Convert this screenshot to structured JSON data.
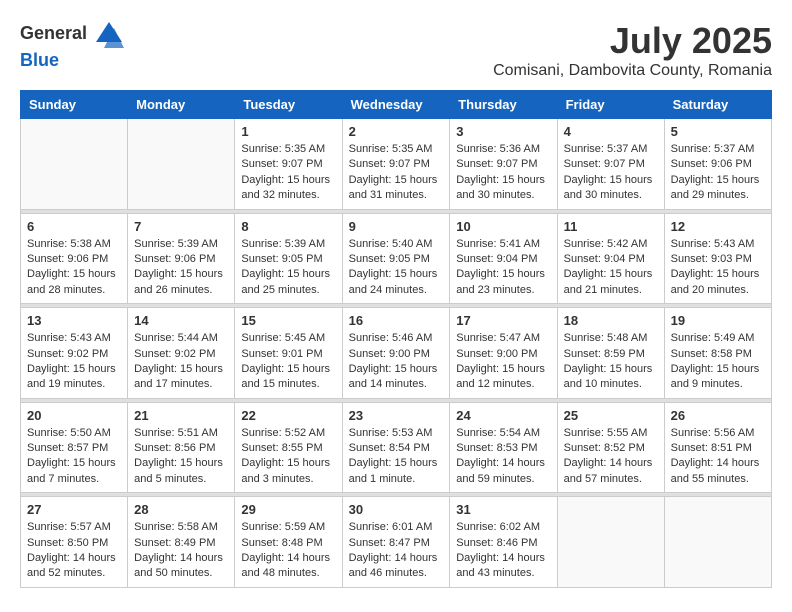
{
  "header": {
    "logo_general": "General",
    "logo_blue": "Blue",
    "month_year": "July 2025",
    "location": "Comisani, Dambovita County, Romania"
  },
  "weekdays": [
    "Sunday",
    "Monday",
    "Tuesday",
    "Wednesday",
    "Thursday",
    "Friday",
    "Saturday"
  ],
  "weeks": [
    [
      {
        "day": "",
        "info": ""
      },
      {
        "day": "",
        "info": ""
      },
      {
        "day": "1",
        "info": "Sunrise: 5:35 AM\nSunset: 9:07 PM\nDaylight: 15 hours and 32 minutes."
      },
      {
        "day": "2",
        "info": "Sunrise: 5:35 AM\nSunset: 9:07 PM\nDaylight: 15 hours and 31 minutes."
      },
      {
        "day": "3",
        "info": "Sunrise: 5:36 AM\nSunset: 9:07 PM\nDaylight: 15 hours and 30 minutes."
      },
      {
        "day": "4",
        "info": "Sunrise: 5:37 AM\nSunset: 9:07 PM\nDaylight: 15 hours and 30 minutes."
      },
      {
        "day": "5",
        "info": "Sunrise: 5:37 AM\nSunset: 9:06 PM\nDaylight: 15 hours and 29 minutes."
      }
    ],
    [
      {
        "day": "6",
        "info": "Sunrise: 5:38 AM\nSunset: 9:06 PM\nDaylight: 15 hours and 28 minutes."
      },
      {
        "day": "7",
        "info": "Sunrise: 5:39 AM\nSunset: 9:06 PM\nDaylight: 15 hours and 26 minutes."
      },
      {
        "day": "8",
        "info": "Sunrise: 5:39 AM\nSunset: 9:05 PM\nDaylight: 15 hours and 25 minutes."
      },
      {
        "day": "9",
        "info": "Sunrise: 5:40 AM\nSunset: 9:05 PM\nDaylight: 15 hours and 24 minutes."
      },
      {
        "day": "10",
        "info": "Sunrise: 5:41 AM\nSunset: 9:04 PM\nDaylight: 15 hours and 23 minutes."
      },
      {
        "day": "11",
        "info": "Sunrise: 5:42 AM\nSunset: 9:04 PM\nDaylight: 15 hours and 21 minutes."
      },
      {
        "day": "12",
        "info": "Sunrise: 5:43 AM\nSunset: 9:03 PM\nDaylight: 15 hours and 20 minutes."
      }
    ],
    [
      {
        "day": "13",
        "info": "Sunrise: 5:43 AM\nSunset: 9:02 PM\nDaylight: 15 hours and 19 minutes."
      },
      {
        "day": "14",
        "info": "Sunrise: 5:44 AM\nSunset: 9:02 PM\nDaylight: 15 hours and 17 minutes."
      },
      {
        "day": "15",
        "info": "Sunrise: 5:45 AM\nSunset: 9:01 PM\nDaylight: 15 hours and 15 minutes."
      },
      {
        "day": "16",
        "info": "Sunrise: 5:46 AM\nSunset: 9:00 PM\nDaylight: 15 hours and 14 minutes."
      },
      {
        "day": "17",
        "info": "Sunrise: 5:47 AM\nSunset: 9:00 PM\nDaylight: 15 hours and 12 minutes."
      },
      {
        "day": "18",
        "info": "Sunrise: 5:48 AM\nSunset: 8:59 PM\nDaylight: 15 hours and 10 minutes."
      },
      {
        "day": "19",
        "info": "Sunrise: 5:49 AM\nSunset: 8:58 PM\nDaylight: 15 hours and 9 minutes."
      }
    ],
    [
      {
        "day": "20",
        "info": "Sunrise: 5:50 AM\nSunset: 8:57 PM\nDaylight: 15 hours and 7 minutes."
      },
      {
        "day": "21",
        "info": "Sunrise: 5:51 AM\nSunset: 8:56 PM\nDaylight: 15 hours and 5 minutes."
      },
      {
        "day": "22",
        "info": "Sunrise: 5:52 AM\nSunset: 8:55 PM\nDaylight: 15 hours and 3 minutes."
      },
      {
        "day": "23",
        "info": "Sunrise: 5:53 AM\nSunset: 8:54 PM\nDaylight: 15 hours and 1 minute."
      },
      {
        "day": "24",
        "info": "Sunrise: 5:54 AM\nSunset: 8:53 PM\nDaylight: 14 hours and 59 minutes."
      },
      {
        "day": "25",
        "info": "Sunrise: 5:55 AM\nSunset: 8:52 PM\nDaylight: 14 hours and 57 minutes."
      },
      {
        "day": "26",
        "info": "Sunrise: 5:56 AM\nSunset: 8:51 PM\nDaylight: 14 hours and 55 minutes."
      }
    ],
    [
      {
        "day": "27",
        "info": "Sunrise: 5:57 AM\nSunset: 8:50 PM\nDaylight: 14 hours and 52 minutes."
      },
      {
        "day": "28",
        "info": "Sunrise: 5:58 AM\nSunset: 8:49 PM\nDaylight: 14 hours and 50 minutes."
      },
      {
        "day": "29",
        "info": "Sunrise: 5:59 AM\nSunset: 8:48 PM\nDaylight: 14 hours and 48 minutes."
      },
      {
        "day": "30",
        "info": "Sunrise: 6:01 AM\nSunset: 8:47 PM\nDaylight: 14 hours and 46 minutes."
      },
      {
        "day": "31",
        "info": "Sunrise: 6:02 AM\nSunset: 8:46 PM\nDaylight: 14 hours and 43 minutes."
      },
      {
        "day": "",
        "info": ""
      },
      {
        "day": "",
        "info": ""
      }
    ]
  ]
}
